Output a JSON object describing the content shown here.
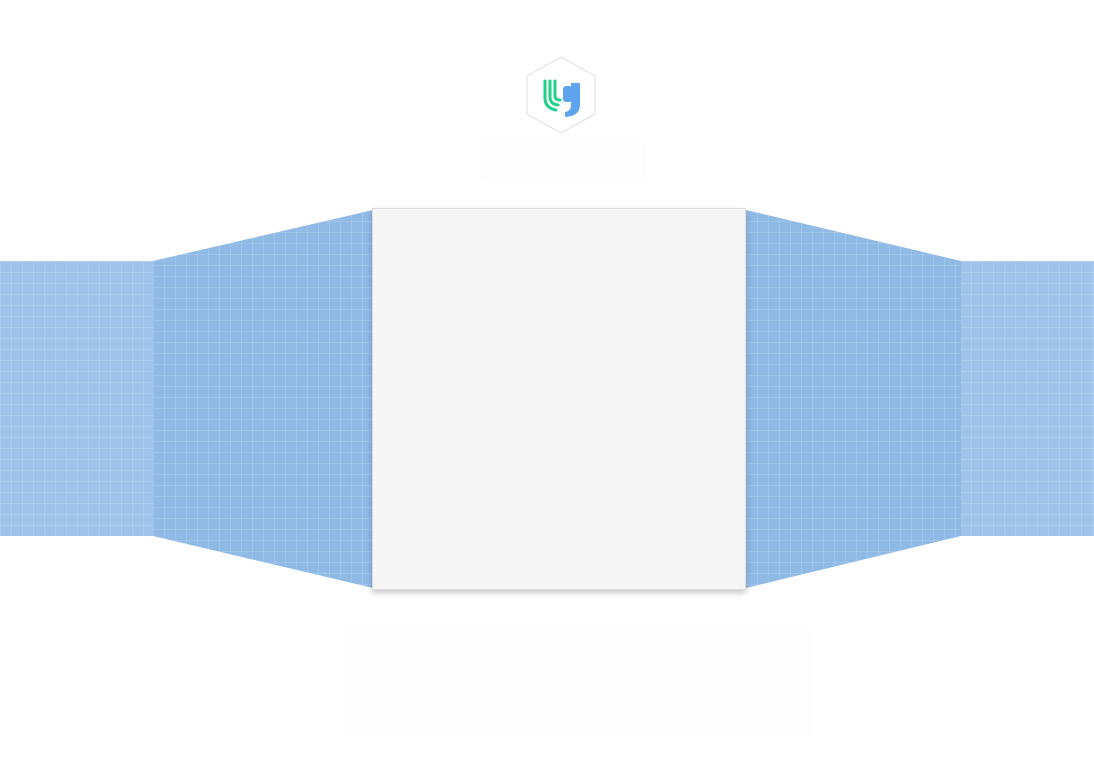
{
  "app": {
    "logo_icon": "y-brand-logo-icon",
    "colors": {
      "logo_green": "#1fd18a",
      "logo_blue": "#5ea3ee",
      "ribbon_blue": "#9fc3ea",
      "ribbon_wing_blue": "#90bae6",
      "card_background": "#f5f5f6",
      "page_background": "#ffffff"
    }
  }
}
